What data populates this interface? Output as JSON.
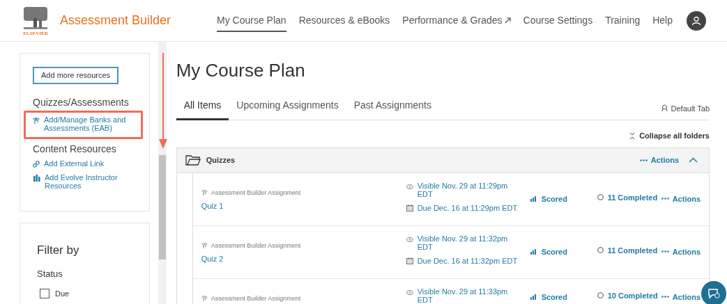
{
  "header": {
    "logo_text": "ELSEVIER",
    "app_title": "Assessment Builder",
    "nav": [
      {
        "label": "My Course Plan",
        "selected": true,
        "external": false
      },
      {
        "label": "Resources & eBooks",
        "selected": false,
        "external": false
      },
      {
        "label": "Performance & Grades",
        "selected": false,
        "external": true
      },
      {
        "label": "Course Settings",
        "selected": false,
        "external": false
      },
      {
        "label": "Training",
        "selected": false,
        "external": false
      },
      {
        "label": "Help",
        "selected": false,
        "external": false
      }
    ]
  },
  "sidebar": {
    "add_button": "Add more resources",
    "sections": [
      {
        "heading": "Quizzes/Assessments",
        "links": [
          {
            "label": "Add/Manage Banks and Assessments (EAB)",
            "kind": "assessment",
            "highlighted": true
          }
        ]
      },
      {
        "heading": "Content Resources",
        "links": [
          {
            "label": "Add External Link",
            "kind": "link",
            "highlighted": false
          },
          {
            "label": "Add Evolve Instructor Resources",
            "kind": "resources",
            "highlighted": false
          }
        ]
      }
    ],
    "filter": {
      "title": "Filter by",
      "group": "Status",
      "options": [
        {
          "label": "Due",
          "checked": false
        }
      ]
    }
  },
  "main": {
    "title": "My Course Plan",
    "tabs": [
      {
        "label": "All Items",
        "selected": true
      },
      {
        "label": "Upcoming Assignments",
        "selected": false
      },
      {
        "label": "Past Assignments",
        "selected": false
      }
    ],
    "default_tab": "Default Tab",
    "collapse_all": "Collapse all folders",
    "folder": {
      "name": "Quizzes",
      "actions": "Actions",
      "expanded": true,
      "items": [
        {
          "type": "Assessment Builder Assignment",
          "name": "Quiz 1",
          "visible": "Visible Nov. 29 at 11:29pm EDT",
          "due": "Due Dec. 16 at 11:29pm EDT",
          "grading": "Scored",
          "completed": "11 Completed",
          "actions": "Actions"
        },
        {
          "type": "Assessment Builder Assignment",
          "name": "Quiz 2",
          "visible": "Visible Nov. 29 at 11:32pm EDT",
          "due": "Due Dec. 16 at 11:32pm EDT",
          "grading": "Scored",
          "completed": "11 Completed",
          "actions": "Actions"
        },
        {
          "type": "Assessment Builder Assignment",
          "visible": "Visible Nov. 29 at 11:33pm EDT",
          "grading": "Scored",
          "completed": "10 Completed",
          "actions": "Actions"
        }
      ]
    }
  }
}
